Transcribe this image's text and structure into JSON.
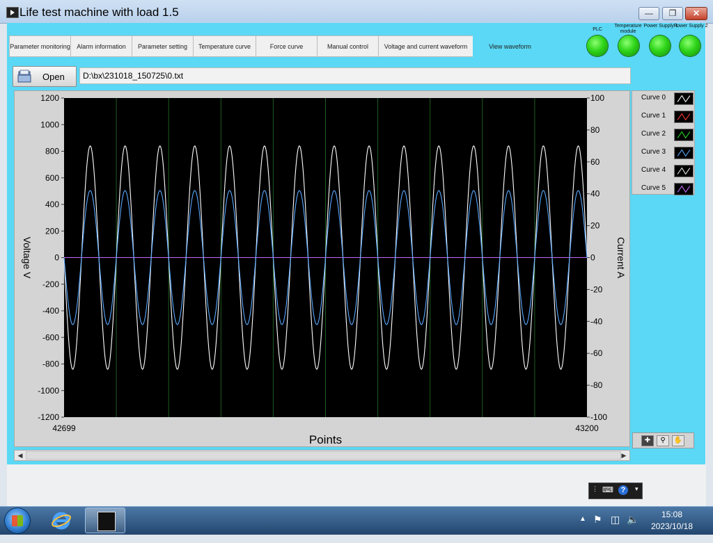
{
  "window": {
    "title": "Life test machine with load 1.5",
    "minimize_icon": "minimize-icon",
    "restore_icon": "restore-icon",
    "close_icon": "close-icon"
  },
  "tabs": [
    {
      "label": "Parameter monitoring"
    },
    {
      "label": "Alarm information"
    },
    {
      "label": "Parameter setting"
    },
    {
      "label": "Temperature curve"
    },
    {
      "label": "Force curve"
    },
    {
      "label": "Manual control"
    },
    {
      "label": "Voltage and current waveform"
    },
    {
      "label": "View waveform",
      "active": true
    }
  ],
  "indicators": [
    {
      "label": "PLC",
      "state": "on",
      "color": "#2fd51a"
    },
    {
      "label": "Temperature module",
      "state": "on",
      "color": "#2fd51a"
    },
    {
      "label": "Power Supply 1",
      "state": "on",
      "color": "#2fd51a"
    },
    {
      "label": "Power Supply 2",
      "state": "on",
      "color": "#2fd51a"
    }
  ],
  "open_button": {
    "label": "Open",
    "icon": "folder-open-icon"
  },
  "file_path": "D:\\bx\\231018_150725\\0.txt",
  "chart_data": {
    "type": "line",
    "xlabel": "Points",
    "ylabel": "Voltage V",
    "y2label": "Current A",
    "xlim": [
      42699,
      43200
    ],
    "ylim": [
      -1200,
      1200
    ],
    "y2lim": [
      -100,
      100
    ],
    "x_ticks": [
      "42699",
      "43200"
    ],
    "y_ticks": [
      "1200",
      "1000",
      "800",
      "600",
      "400",
      "200",
      "0",
      "-200",
      "-400",
      "-600",
      "-800",
      "-1000",
      "-1200"
    ],
    "y2_ticks": [
      "100",
      "80",
      "60",
      "40",
      "20",
      "0",
      "-20",
      "-40",
      "-60",
      "-80",
      "-100"
    ],
    "grid": "vertical",
    "background": "#000000",
    "series": [
      {
        "name": "Curve 0",
        "color": "#ffffff",
        "axis": "left",
        "waveform": "sine",
        "amplitude": 840,
        "cycles": 15,
        "phase_deg": 0
      },
      {
        "name": "Curve 1",
        "color": "#ff3b3b",
        "axis": "left",
        "waveform": "flat",
        "value": 0
      },
      {
        "name": "Curve 2",
        "color": "#22dd22",
        "axis": "left",
        "waveform": "flat",
        "value": 0
      },
      {
        "name": "Curve 3",
        "color": "#5aa8ff",
        "axis": "right",
        "waveform": "sine",
        "amplitude": 42,
        "cycles": 15,
        "phase_deg": 0
      },
      {
        "name": "Curve 4",
        "color": "#eaeaea",
        "axis": "right",
        "waveform": "flat",
        "value": 0
      },
      {
        "name": "Curve 5",
        "color": "#c06cff",
        "axis": "right",
        "waveform": "flat",
        "value": 0
      }
    ]
  },
  "graph_tools": [
    {
      "name": "cursor-tool-icon",
      "active": true
    },
    {
      "name": "zoom-tool-icon",
      "active": false
    },
    {
      "name": "pan-tool-icon",
      "active": false
    }
  ],
  "taskbar": {
    "time": "15:08",
    "date": "2023/10/18"
  }
}
